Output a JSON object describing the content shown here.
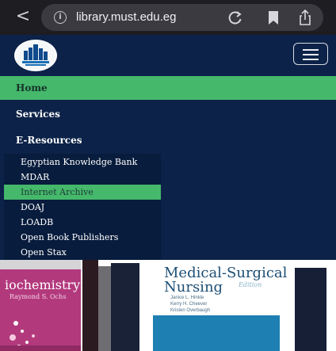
{
  "browser": {
    "back_symbol": "<",
    "url": "library.must.edu.eg",
    "info_symbol": "i"
  },
  "site": {
    "logo_alt": "MUST Central Library",
    "nav": [
      {
        "label": "Home",
        "active": true
      },
      {
        "label": "Services",
        "active": false
      },
      {
        "label": "E-Resources",
        "active": false
      }
    ],
    "eresources": [
      {
        "label": "Egyptian Knowledge Bank",
        "active": false
      },
      {
        "label": "MDAR",
        "active": false
      },
      {
        "label": "Internet Archive",
        "active": true
      },
      {
        "label": "DOAJ",
        "active": false
      },
      {
        "label": "LOADB",
        "active": false
      },
      {
        "label": "Open Book Publishers",
        "active": false
      },
      {
        "label": "Open Stax",
        "active": false
      }
    ]
  },
  "books": {
    "book1_title": "iochemistry",
    "book1_author": "Raymond S. Ochs",
    "book2_title_line1": "Medical-Surgical",
    "book2_title_line2": "Nursing",
    "book2_edition": "Edition",
    "book2_authors": "Janice L. Hinkle\nKerry H. Cheever\nKristen Overbaugh"
  },
  "colors": {
    "navy": "#0c2248",
    "accent_green": "#45b86b",
    "browser_chrome": "#1d1d22"
  }
}
